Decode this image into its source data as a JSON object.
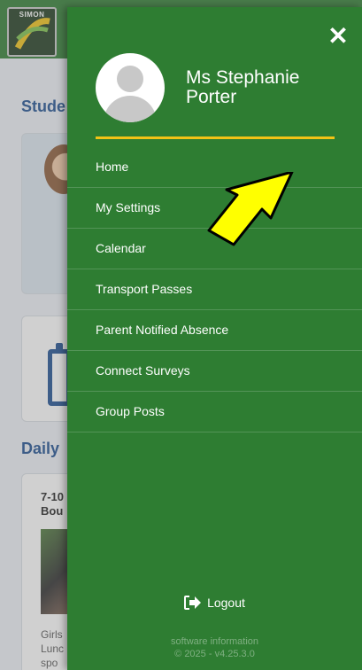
{
  "background": {
    "logo_text": "SIMON",
    "students_heading": "Stude",
    "daily_heading": "Daily",
    "news_title": "7-10\nBou",
    "news_text": "Girls\nLunc\nspo"
  },
  "drawer": {
    "close_label": "✕",
    "profile_name": "Ms Stephanie Porter",
    "menu": [
      {
        "label": "Home"
      },
      {
        "label": "My Settings"
      },
      {
        "label": "Calendar"
      },
      {
        "label": "Transport Passes"
      },
      {
        "label": "Parent Notified Absence"
      },
      {
        "label": "Connect Surveys"
      },
      {
        "label": "Group Posts"
      }
    ],
    "logout_label": "Logout",
    "software_info_label": "software information",
    "version_label": "© 2025 - v4.25.3.0"
  },
  "colors": {
    "drawer_green": "#2e7d32",
    "divider_gold": "#f2c316",
    "arrow_yellow": "#ffff00",
    "heading_blue": "#1e4f91"
  },
  "icons": {
    "close": "close-icon",
    "avatar": "user-avatar-icon",
    "logout": "logout-icon",
    "arrow": "annotation-arrow"
  }
}
